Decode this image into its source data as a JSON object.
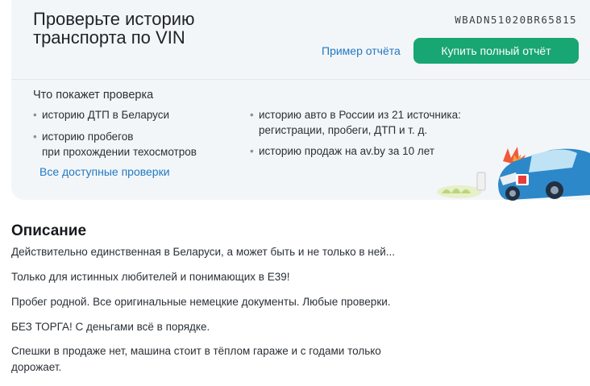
{
  "vin_check": {
    "title": "Проверьте историю транспорта по VIN",
    "vin": "WBADN51020BR65815",
    "sample_link": "Пример отчёта",
    "buy_button": "Купить полный отчёт",
    "checks_heading": "Что покажет проверка",
    "checks_left": [
      "историю ДТП в Беларуси",
      "историю пробегов\nпри прохождении техосмотров"
    ],
    "checks_right": [
      "историю авто в России из 21 источника:\nрегистрации, пробеги, ДТП и т. д.",
      "историю продаж на av.by за 10 лет"
    ],
    "bullet": "•",
    "all_checks_link": "Все доступные проверки",
    "illustration_icon": "crashed-car-illustration",
    "colors": {
      "accent": "#18a673",
      "link": "#2379c2",
      "card_bg": "#f3f6f9"
    }
  },
  "description": {
    "heading": "Описание",
    "lines": [
      "Действительно единственная в Беларуси, а может быть и не только в ней...",
      "Только для истинных любителей и понимающих в Е39!",
      "Пробег родной. Все оригинальные немецкие документы. Любые проверки.",
      "БЕЗ ТОРГА! С деньгами всё в порядке.",
      "Спешки в продаже нет, машина стоит в тёплом гараже и с годами только\nдорожает."
    ]
  }
}
